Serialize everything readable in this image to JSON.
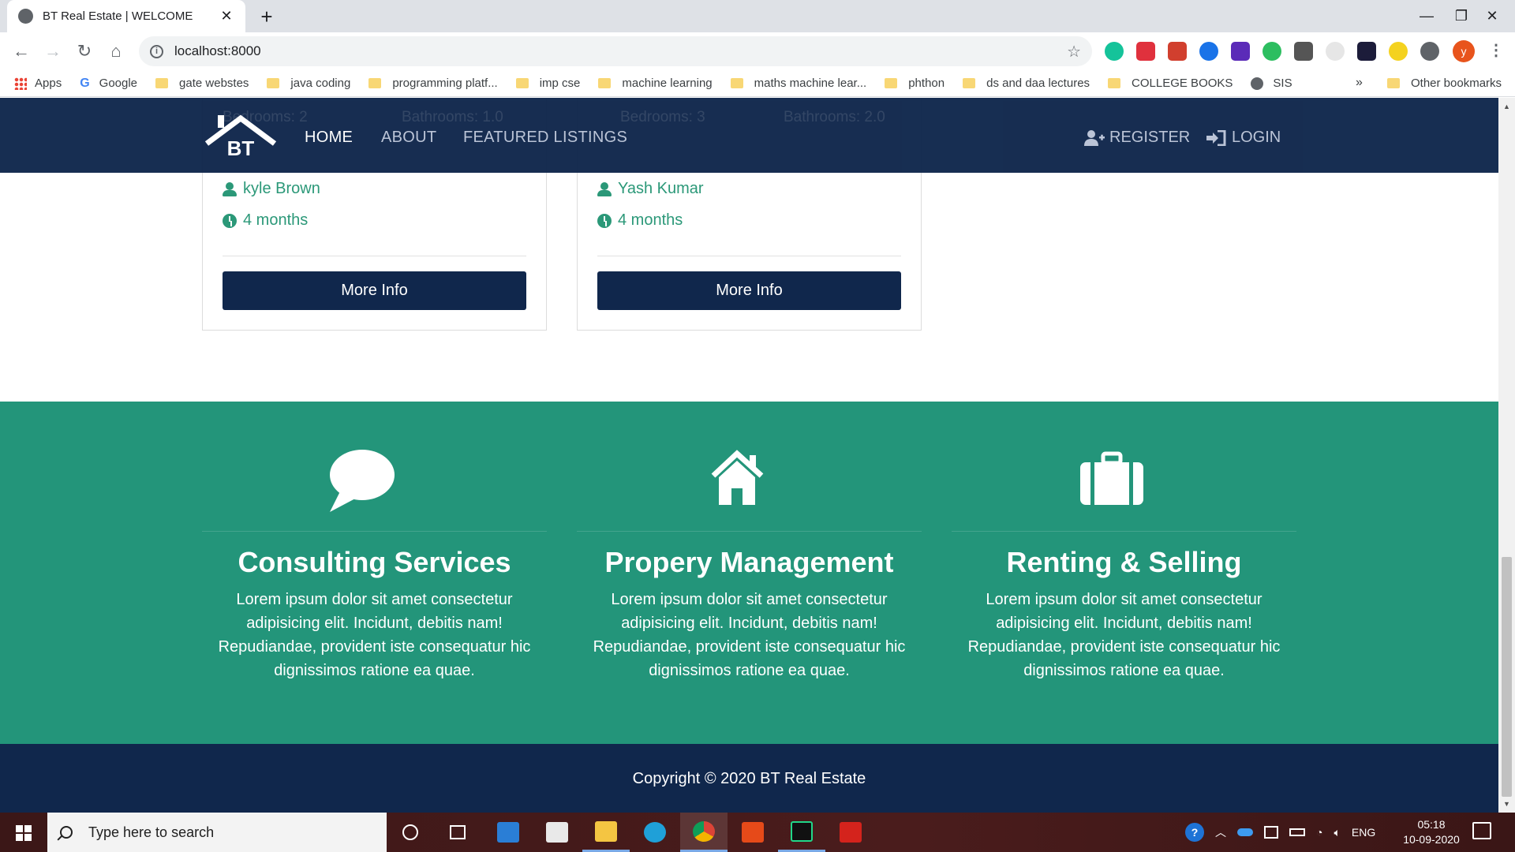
{
  "browser": {
    "tab_title": "BT Real Estate | WELCOME",
    "url": "localhost:8000",
    "profile_initial": "y",
    "bookmarks": [
      {
        "label": "Apps",
        "icon": "apps-grid-icon"
      },
      {
        "label": "Google",
        "icon": "google-icon"
      },
      {
        "label": "gate webstes",
        "icon": "folder-icon"
      },
      {
        "label": "java coding",
        "icon": "folder-icon"
      },
      {
        "label": "programming platf...",
        "icon": "folder-icon"
      },
      {
        "label": "imp cse",
        "icon": "folder-icon"
      },
      {
        "label": "machine learning",
        "icon": "folder-icon"
      },
      {
        "label": "maths machine lear...",
        "icon": "folder-icon"
      },
      {
        "label": "phthon",
        "icon": "folder-icon"
      },
      {
        "label": "ds and daa lectures",
        "icon": "folder-icon"
      },
      {
        "label": "COLLEGE BOOKS",
        "icon": "folder-icon"
      },
      {
        "label": "SIS",
        "icon": "globe-icon"
      }
    ],
    "bookmarks_overflow": "»",
    "other_bookmarks": "Other bookmarks"
  },
  "navbar": {
    "brand": "BT",
    "links": [
      "HOME",
      "ABOUT",
      "FEATURED LISTINGS"
    ],
    "register": "REGISTER",
    "login": "LOGIN",
    "ghost_text": [
      "Bedrooms: 2",
      "Bathrooms: 1.0",
      "Bedrooms: 3",
      "Bathrooms: 2.0"
    ]
  },
  "listings": [
    {
      "realtor": "kyle Brown",
      "age": "4 months",
      "button": "More Info"
    },
    {
      "realtor": "Yash Kumar",
      "age": "4 months",
      "button": "More Info"
    }
  ],
  "services": [
    {
      "icon": "speech-bubble-icon",
      "title": "Consulting Services",
      "text": "Lorem ipsum dolor sit amet consectetur adipisicing elit. Incidunt, debitis nam! Repudiandae, provident iste consequatur hic dignissimos ratione ea quae."
    },
    {
      "icon": "home-icon",
      "title": "Propery Management",
      "text": "Lorem ipsum dolor sit amet consectetur adipisicing elit. Incidunt, debitis nam! Repudiandae, provident iste consequatur hic dignissimos ratione ea quae."
    },
    {
      "icon": "suitcase-icon",
      "title": "Renting & Selling",
      "text": "Lorem ipsum dolor sit amet consectetur adipisicing elit. Incidunt, debitis nam! Repudiandae, provident iste consequatur hic dignissimos ratione ea quae."
    }
  ],
  "footer": {
    "copyright": "Copyright © 2020 BT Real Estate"
  },
  "taskbar": {
    "search_placeholder": "Type here to search",
    "language": "ENG",
    "time": "05:18",
    "date": "10-09-2020"
  },
  "colors": {
    "navy": "#10274c",
    "green": "#23957a",
    "accent_text": "#2b9878"
  }
}
